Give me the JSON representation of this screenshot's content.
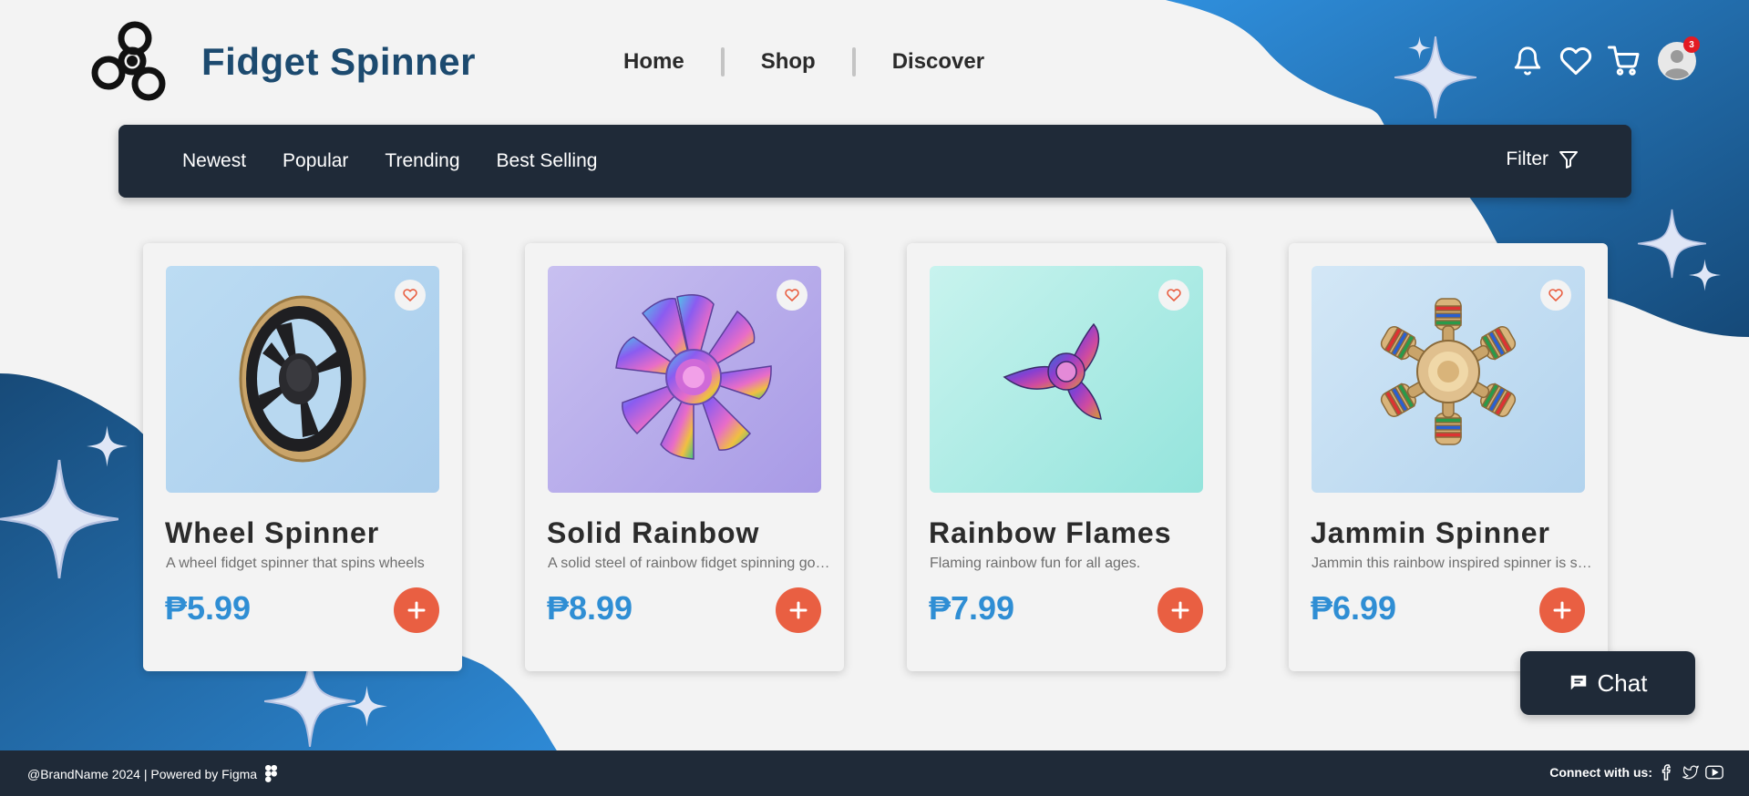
{
  "brand": {
    "name": "Fidget Spinner",
    "logo_icon": "fidget-spinner-logo"
  },
  "nav": {
    "items": [
      "Home",
      "Shop",
      "Discover"
    ]
  },
  "header_icons": {
    "notification_count": "3"
  },
  "categories": {
    "tabs": [
      "Newest",
      "Popular",
      "Trending",
      "Best Selling"
    ],
    "filter_label": "Filter"
  },
  "products": [
    {
      "name": "Wheel Spinner",
      "description": "A wheel fidget spinner that spins wheels",
      "price": "₱5.99",
      "image_bg": [
        "#bcdcf3",
        "#a9cdec"
      ]
    },
    {
      "name": "Solid Rainbow",
      "description": "A solid steel of rainbow fidget spinning goodness",
      "price": "₱8.99",
      "image_bg": [
        "#c8c0f0",
        "#a89ae6"
      ]
    },
    {
      "name": "Rainbow Flames",
      "description": "Flaming rainbow fun for all ages.",
      "price": "₱7.99",
      "image_bg": [
        "#c8f3ee",
        "#94e4dc"
      ]
    },
    {
      "name": "Jammin Spinner",
      "description": "Jammin this rainbow inspired spinner is sure to please",
      "price": "₱6.99",
      "image_bg": [
        "#d3e7f6",
        "#b2d3ee"
      ]
    }
  ],
  "chat": {
    "label": "Chat"
  },
  "footer": {
    "copyright": "@BrandName 2024 | Powered by Figma",
    "connect_label": "Connect with us:"
  },
  "colors": {
    "dark_navy": "#1f2a38",
    "brand_blue": "#1c4a6f",
    "price_blue": "#2f8ed4",
    "accent_orange": "#e95f42",
    "blob_blue": "#2a84d0"
  }
}
